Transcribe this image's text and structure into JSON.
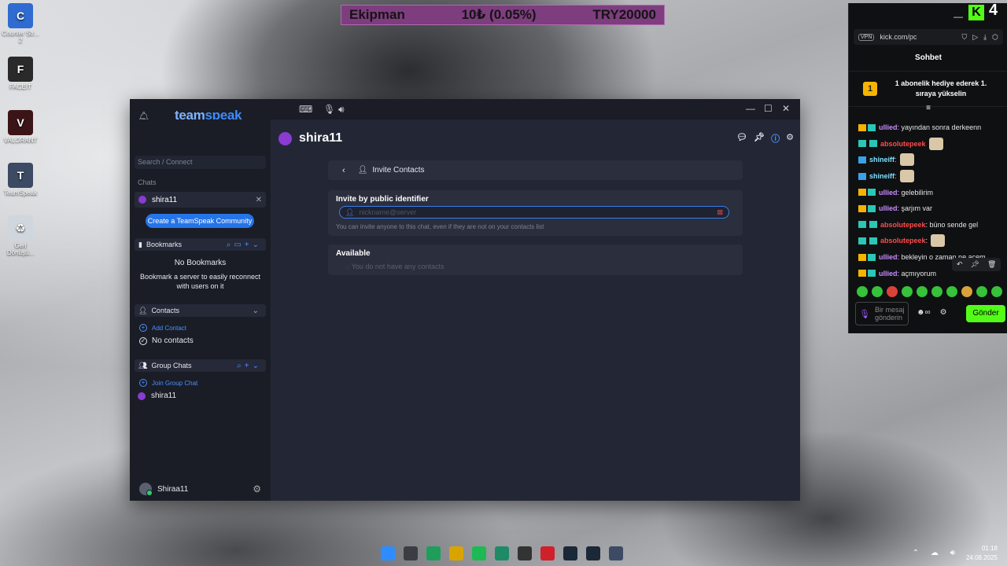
{
  "desktop": {
    "icons": [
      {
        "label": "Counter Str... 2",
        "color": "#2f6bd1",
        "glyph": "C"
      },
      {
        "label": "FACEIT",
        "color": "#2a2a2a",
        "glyph": "F"
      },
      {
        "label": "VALORANT",
        "color": "#3a1416",
        "glyph": "V"
      },
      {
        "label": "TeamSpeak",
        "color": "#3c4a64",
        "glyph": "T"
      },
      {
        "label": "Geri Dönüşü...",
        "color": "#cfd6dd",
        "glyph": "♻"
      }
    ]
  },
  "overlay": {
    "left": "Ekipman",
    "middle": "10₺ (0.05%)",
    "right": "TRY20000"
  },
  "teamspeak": {
    "logo_a": "team",
    "logo_b": "speak",
    "search_placeholder": "Search / Connect",
    "chats_label": "Chats",
    "active_chat": "shira11",
    "create_community": "Create a TeamSpeak Community",
    "bookmarks_label": "Bookmarks",
    "no_bookmarks": "No Bookmarks",
    "bookmarks_hint": "Bookmark a server to easily reconnect with users on it",
    "contacts_label": "Contacts",
    "add_contact": "Add Contact",
    "no_contacts": "No contacts",
    "group_chats_label": "Group Chats",
    "join_group_chat": "Join Group Chat",
    "group_chat_item": "shira11",
    "username": "Shiraa11",
    "header_title": "shira11",
    "invite_contacts": "Invite Contacts",
    "invite_by_id": "Invite by public identifier",
    "id_placeholder": "nickname@server",
    "invite_hint": "You can invite anyone to this chat, even if they are not on your contacts list",
    "available_label": "Available",
    "available_empty": "You do not have any contacts",
    "colors": {
      "accent": "#2574e8",
      "brand": "#8b3bd1"
    }
  },
  "kick": {
    "viewer_count": "4",
    "url": "kick.com/pc",
    "title": "Sohbet",
    "gift_badge": "1",
    "gift_text": "1 abonelik hediye ederek 1. sıraya yükselin",
    "messages": [
      {
        "user": "ullied",
        "color": "#c98bff",
        "text": ": yayından sonra derkeenn",
        "emote": false,
        "badge": "sub"
      },
      {
        "user": "absolutepeek",
        "color": "#ff4b4b",
        "text": "",
        "emote": true,
        "badge": "mod"
      },
      {
        "user": "shineiff",
        "color": "#7de0ff",
        "text": ":",
        "emote": true,
        "badge": "vip"
      },
      {
        "user": "shineiff",
        "color": "#7de0ff",
        "text": ":",
        "emote": true,
        "badge": "vip"
      },
      {
        "user": "ullied",
        "color": "#c98bff",
        "text": ": gelebilirim",
        "emote": false,
        "badge": "sub"
      },
      {
        "user": "ullied",
        "color": "#c98bff",
        "text": ": şarjım var",
        "emote": false,
        "badge": "sub"
      },
      {
        "user": "absolutepeek",
        "color": "#ff4b4b",
        "text": ": büno sende gel",
        "emote": false,
        "badge": "mod"
      },
      {
        "user": "absolutepeek",
        "color": "#ff4b4b",
        "text": ":",
        "emote": true,
        "badge": "mod"
      },
      {
        "user": "ullied",
        "color": "#c98bff",
        "text": ": bekleyin o zaman ne acem",
        "emote": false,
        "badge": "sub"
      },
      {
        "user": "ullied",
        "color": "#c98bff",
        "text": ": açmıyorum",
        "emote": false,
        "badge": "sub"
      }
    ],
    "input_placeholder": "Bir mesaj gönderin",
    "send_label": "Gönder"
  },
  "taskbar": {
    "time": "01:18",
    "date": "24.08.2025",
    "apps": [
      "#2f8cff",
      "#3a3d44",
      "#1e9e5a",
      "#d9a400",
      "#1db954",
      "#1e8a66",
      "#333",
      "#d0202a",
      "#1b2838",
      "#1b2838",
      "#3c4a64"
    ]
  }
}
